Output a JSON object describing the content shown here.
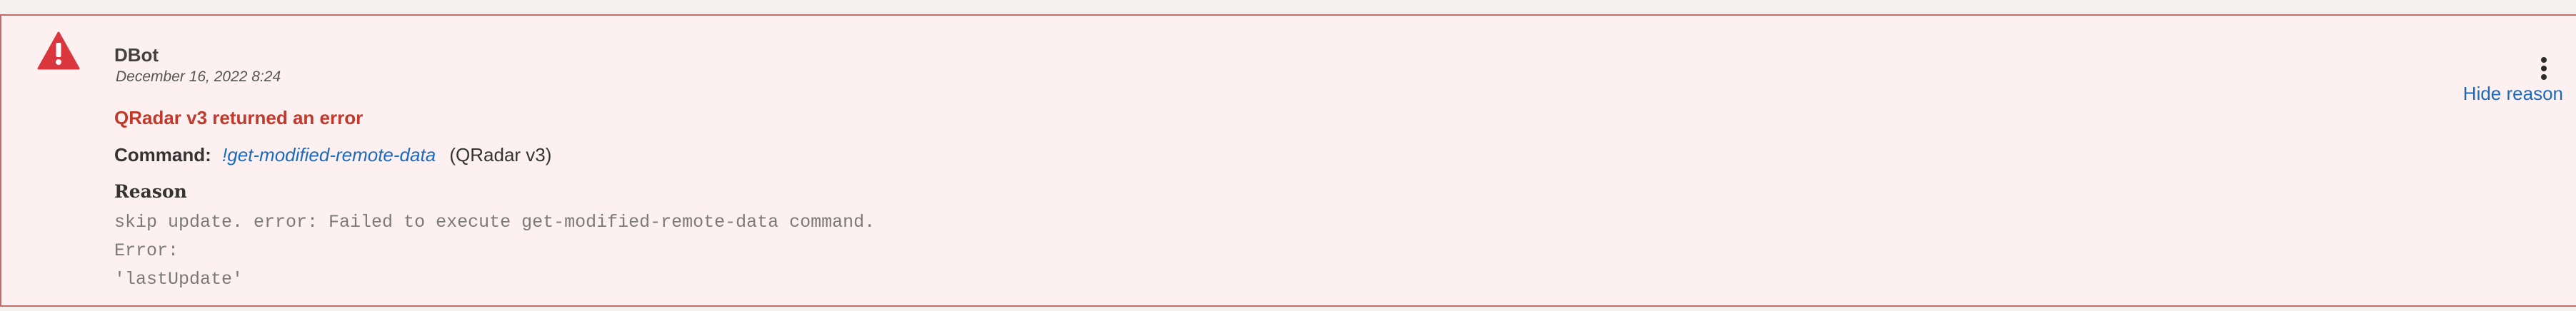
{
  "entry": {
    "author": "DBot",
    "timestamp": "December 16, 2022 8:24",
    "icon": "warning-triangle-icon",
    "status_color": "#d9363e",
    "error_title": "QRadar v3 returned an error",
    "command_label": "Command:",
    "command_name": "!get-modified-remote-data",
    "command_source": "(QRadar v3)",
    "reason_label": "Reason",
    "reason_text": "skip update. error: Failed to execute get-modified-remote-data command.\nError:\n'lastUpdate'",
    "actions": {
      "menu_icon": "kebab-menu-icon",
      "hide_reason_label": "Hide reason"
    }
  }
}
